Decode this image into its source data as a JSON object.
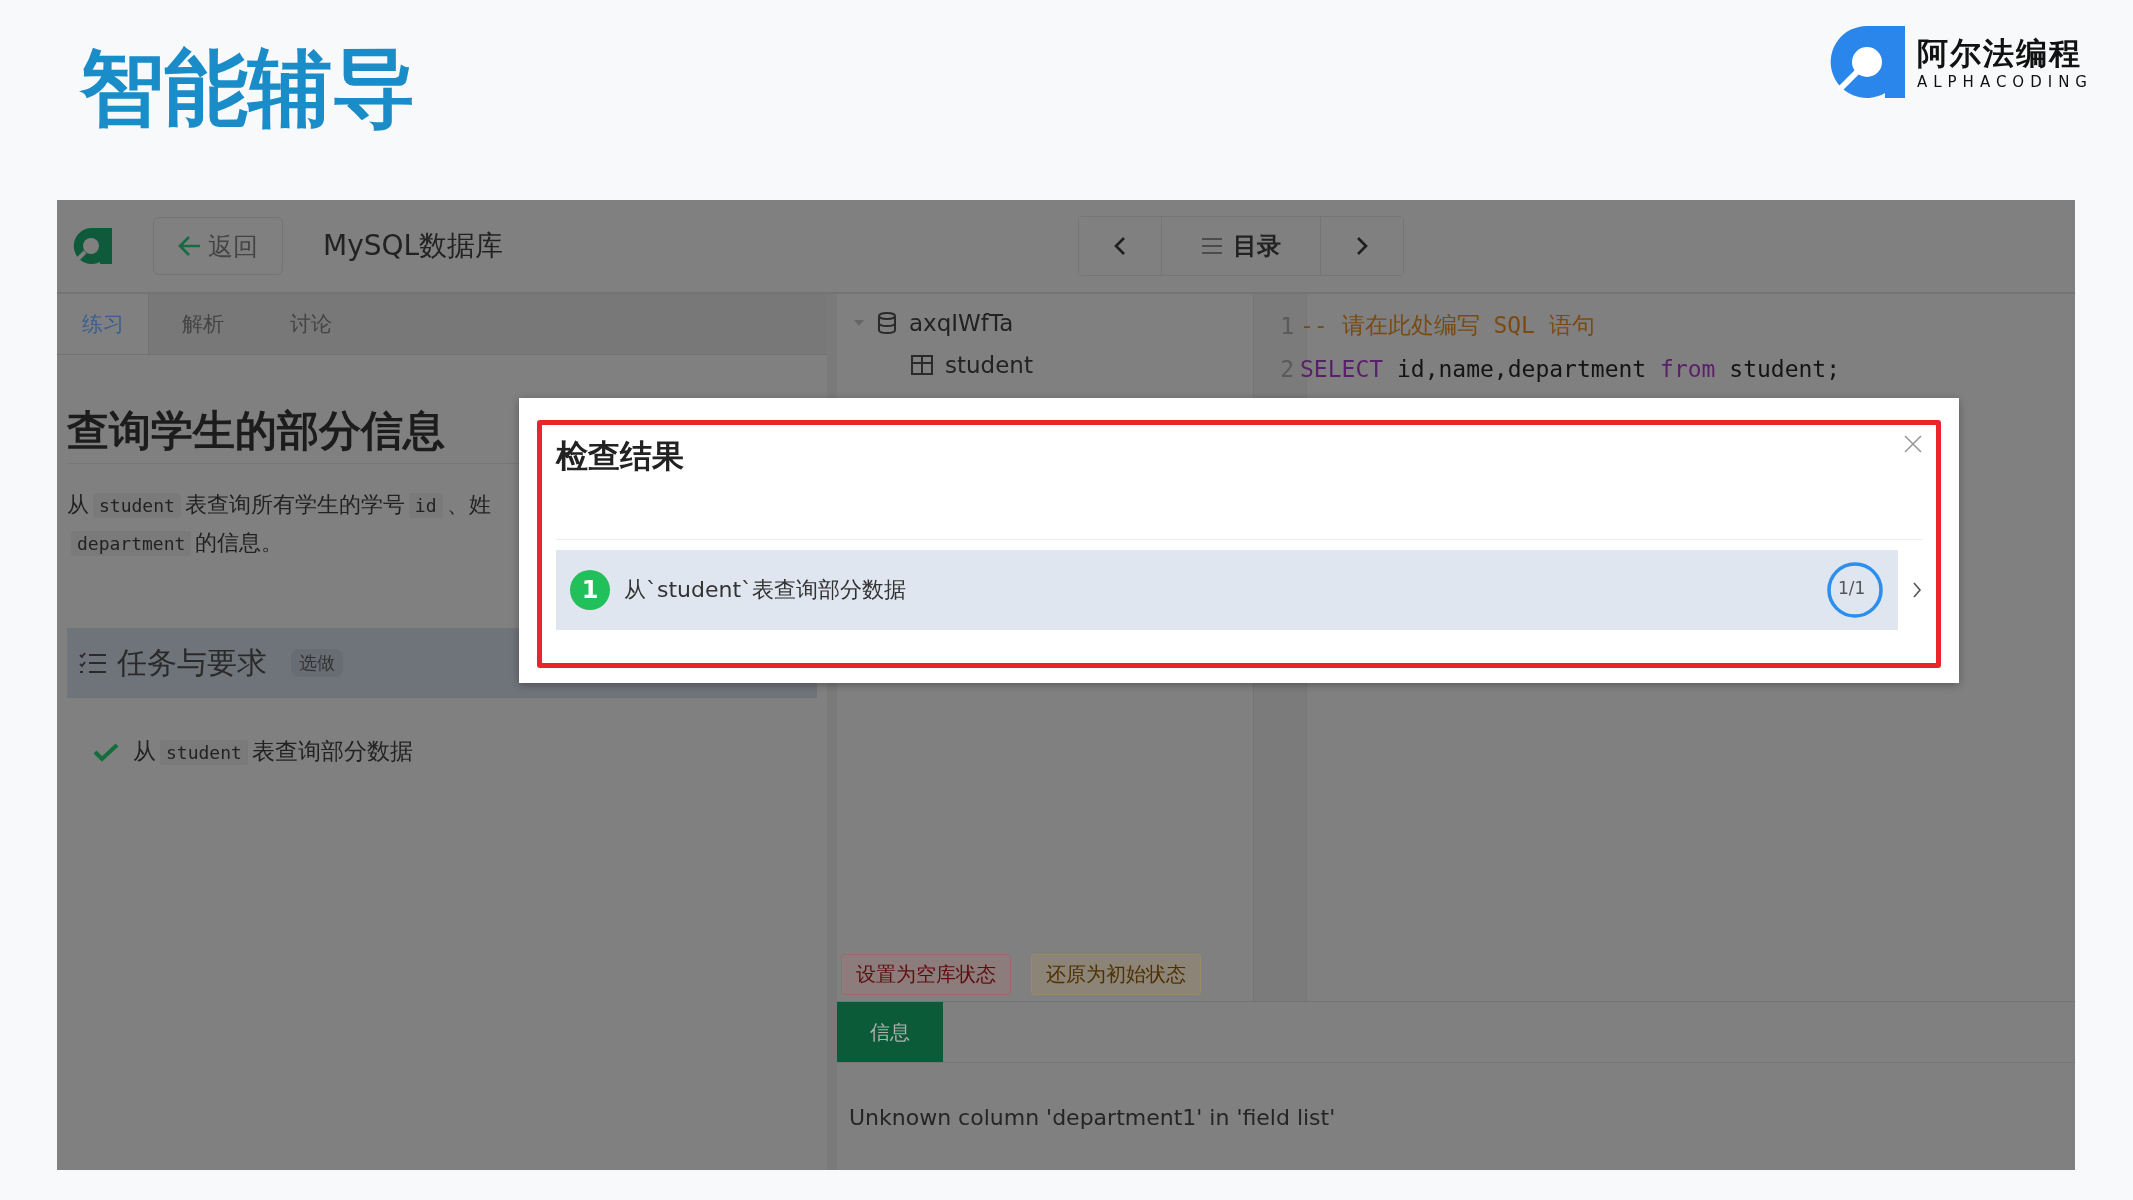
{
  "slide_title": "智能辅导",
  "brand": {
    "name": "阿尔法编程",
    "tagline": "ALPHACODING"
  },
  "app": {
    "back_button": "返回",
    "title": "MySQL数据库",
    "catalog_button": "目录",
    "tabs": [
      {
        "label": "练习",
        "selected": true
      },
      {
        "label": "解析",
        "selected": false
      },
      {
        "label": "讨论",
        "selected": false
      }
    ],
    "exercise": {
      "title": "查询学生的部分信息",
      "description": [
        {
          "kind": "text",
          "text": "从"
        },
        {
          "kind": "code",
          "text": "student"
        },
        {
          "kind": "text",
          "text": "表查询所有学生的学号"
        },
        {
          "kind": "code",
          "text": "id"
        },
        {
          "kind": "text",
          "text": "、姓"
        },
        {
          "kind": "break"
        },
        {
          "kind": "code",
          "text": "department"
        },
        {
          "kind": "text",
          "text": "的信息。"
        }
      ]
    },
    "tasks": {
      "title": "任务与要求",
      "badge": "选做",
      "items": [
        {
          "done": true,
          "parts": [
            {
              "kind": "text",
              "text": "从"
            },
            {
              "kind": "code",
              "text": "student"
            },
            {
              "kind": "text",
              "text": "表查询部分数据"
            }
          ]
        }
      ]
    },
    "database": {
      "name": "axqIWfTa",
      "expanded": true,
      "children": [
        {
          "name": "student"
        }
      ]
    },
    "editor": {
      "lines": [
        {
          "number": "1",
          "tokens": [
            {
              "kind": "comment",
              "text": "-- 请在此处编写 SQL 语句"
            }
          ]
        },
        {
          "number": "2",
          "tokens": [
            {
              "kind": "keyword",
              "text": "SELECT"
            },
            {
              "kind": "plain",
              "text": " id,name,department "
            },
            {
              "kind": "keyword",
              "text": "from"
            },
            {
              "kind": "plain",
              "text": " student;"
            }
          ]
        }
      ]
    },
    "db_buttons": [
      {
        "kind": "danger",
        "label": "设置为空库状态"
      },
      {
        "kind": "warning",
        "label": "还原为初始状态"
      }
    ],
    "output_tabs": [
      {
        "label": "信息",
        "selected": true
      }
    ],
    "message": "Unknown column 'department1' in 'field list'"
  },
  "dialog": {
    "title": "检查结果",
    "results": [
      {
        "number": "1",
        "text": "从`student`表查询部分数据",
        "progress": "1/1",
        "level": 1
      }
    ]
  }
}
